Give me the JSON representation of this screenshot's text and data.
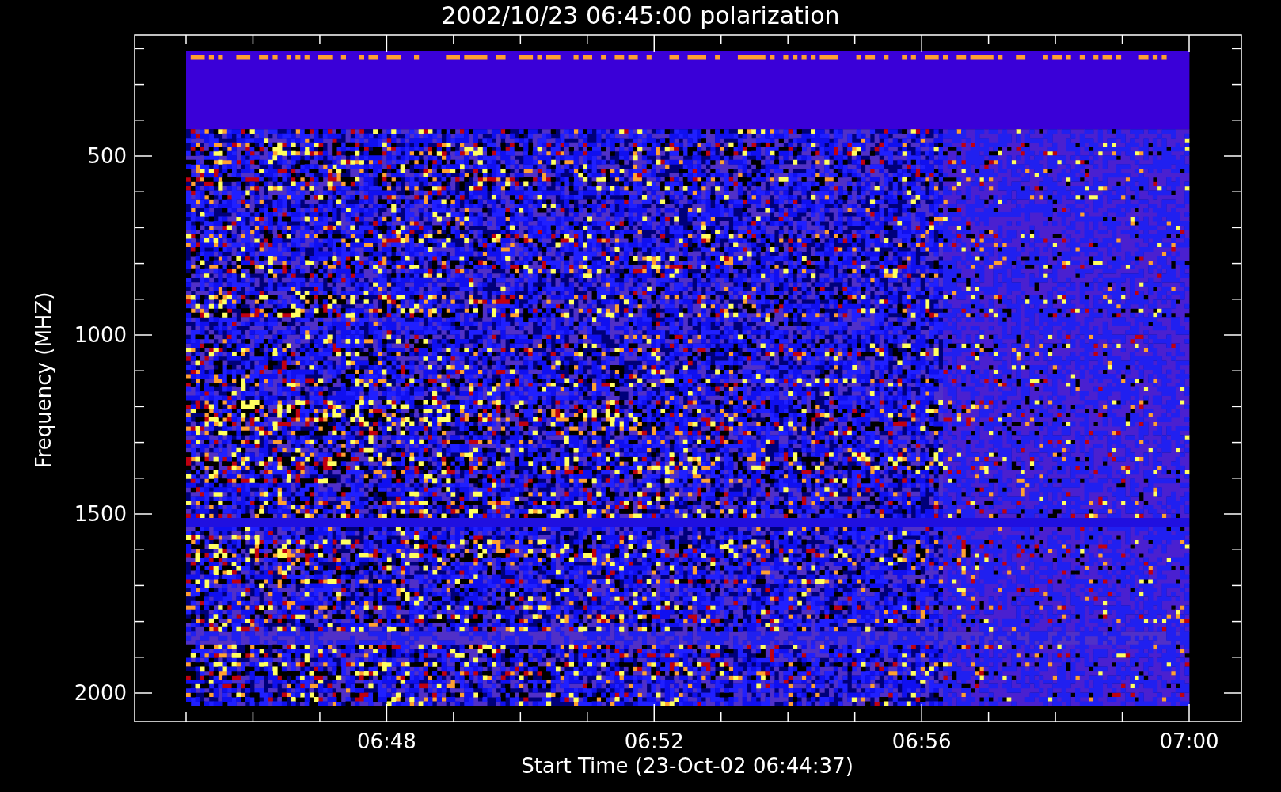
{
  "plot": {
    "title": "2002/10/23 06:45:00 polarization",
    "ylabel": "Frequency (MHZ)",
    "xlabel": "Start Time (23-Oct-02 06:44:37)",
    "yticks": [
      "500",
      "1000",
      "1500",
      "2000"
    ],
    "xticks": [
      "06:48",
      "06:52",
      "06:56",
      "07:00"
    ]
  }
}
